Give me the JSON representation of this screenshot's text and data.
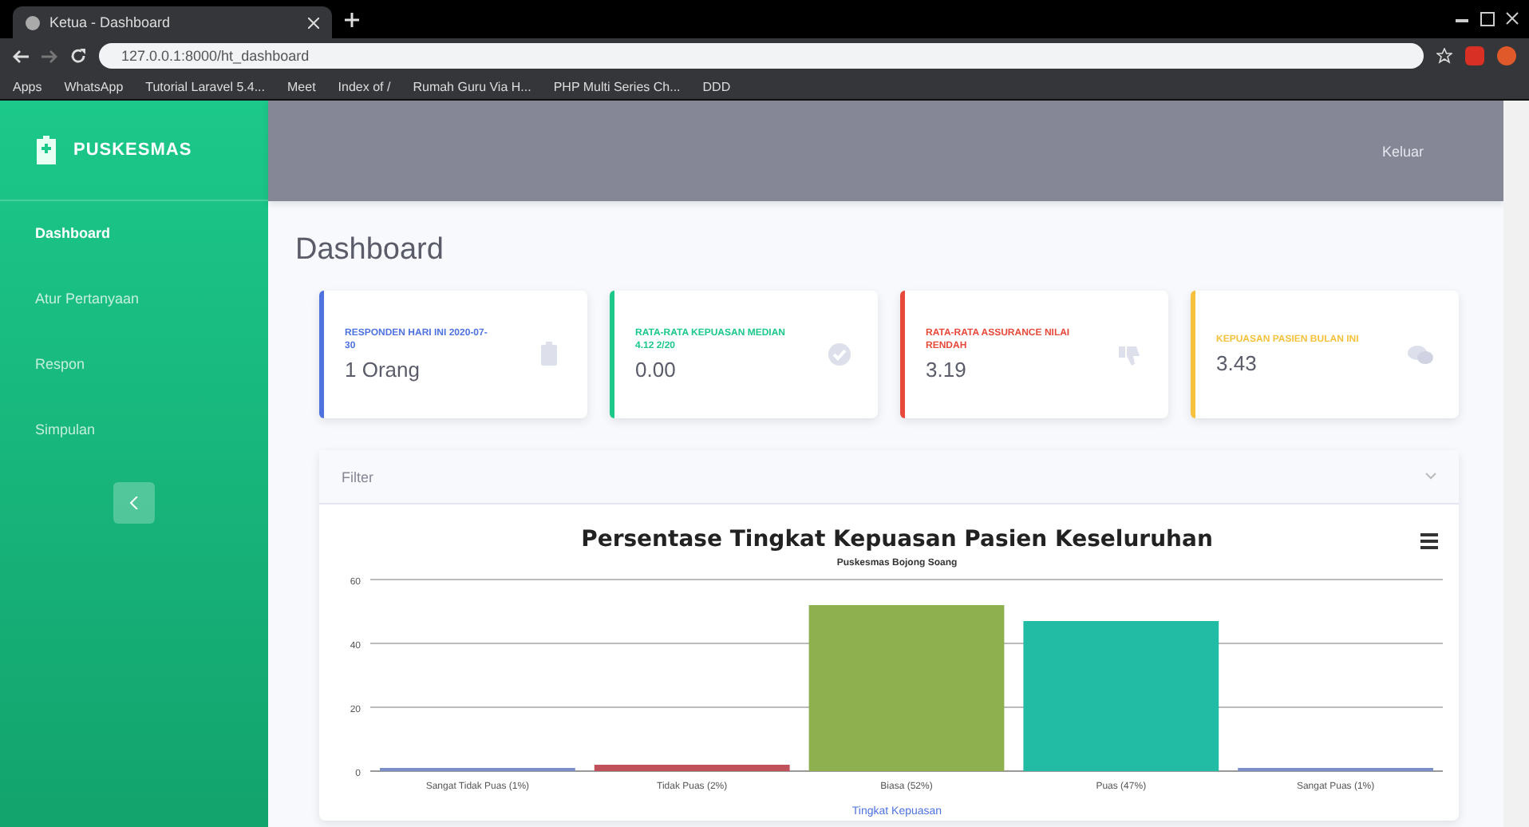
{
  "browser": {
    "tab_title": "Ketua - Dashboard",
    "url": "127.0.0.1:8000/ht_dashboard",
    "bookmarks": [
      "Apps",
      "WhatsApp",
      "Tutorial Laravel 5.4...",
      "Meet",
      "Index of /",
      "Rumah Guru Via H...",
      "PHP Multi Series Ch...",
      "DDD"
    ]
  },
  "sidebar": {
    "brand": "PUSKESMAS",
    "items": [
      {
        "label": "Dashboard",
        "selected": true
      },
      {
        "label": "Atur Pertanyaan",
        "selected": false
      },
      {
        "label": "Respon",
        "selected": false
      },
      {
        "label": "Simpulan",
        "selected": false
      }
    ]
  },
  "topbar": {
    "logout": "Keluar"
  },
  "page_title": "Dashboard",
  "cards": [
    {
      "label": "RESPONDEN HARI INI 2020-07-30",
      "value": "1 Orang",
      "color": "#4e73df"
    },
    {
      "label": "RATA-RATA KEPUASAN MEDIAN 4.12 2/20",
      "value": "0.00",
      "color": "#1cc88a"
    },
    {
      "label": "RATA-RATA ASSURANCE NILAI RENDAH",
      "value": "3.19",
      "color": "#e74a3b"
    },
    {
      "label": "KEPUASAN PASIEN BULAN INI",
      "value": "3.43",
      "color": "#f6c23e"
    }
  ],
  "filter": {
    "title": "Filter"
  },
  "chart": {
    "chart_data": {
      "type": "bar",
      "title": "Persentase Tingkat Kepuasan Pasien Keseluruhan",
      "subtitle": "Puskesmas Bojong Soang",
      "xlabel": "Tingkat Kepuasan",
      "categories": [
        "Sangat Tidak Puas (1%)",
        "Tidak Puas (2%)",
        "Biasa (52%)",
        "Puas (47%)",
        "Sangat Puas (1%)"
      ],
      "values": [
        1,
        2,
        52,
        47,
        1
      ],
      "colors": [
        "#7c8fc7",
        "#c0505a",
        "#8fb04f",
        "#22bba4",
        "#7c8fc7"
      ],
      "ylim": [
        0,
        60
      ],
      "yticks": [
        0,
        20,
        40,
        60
      ]
    }
  }
}
